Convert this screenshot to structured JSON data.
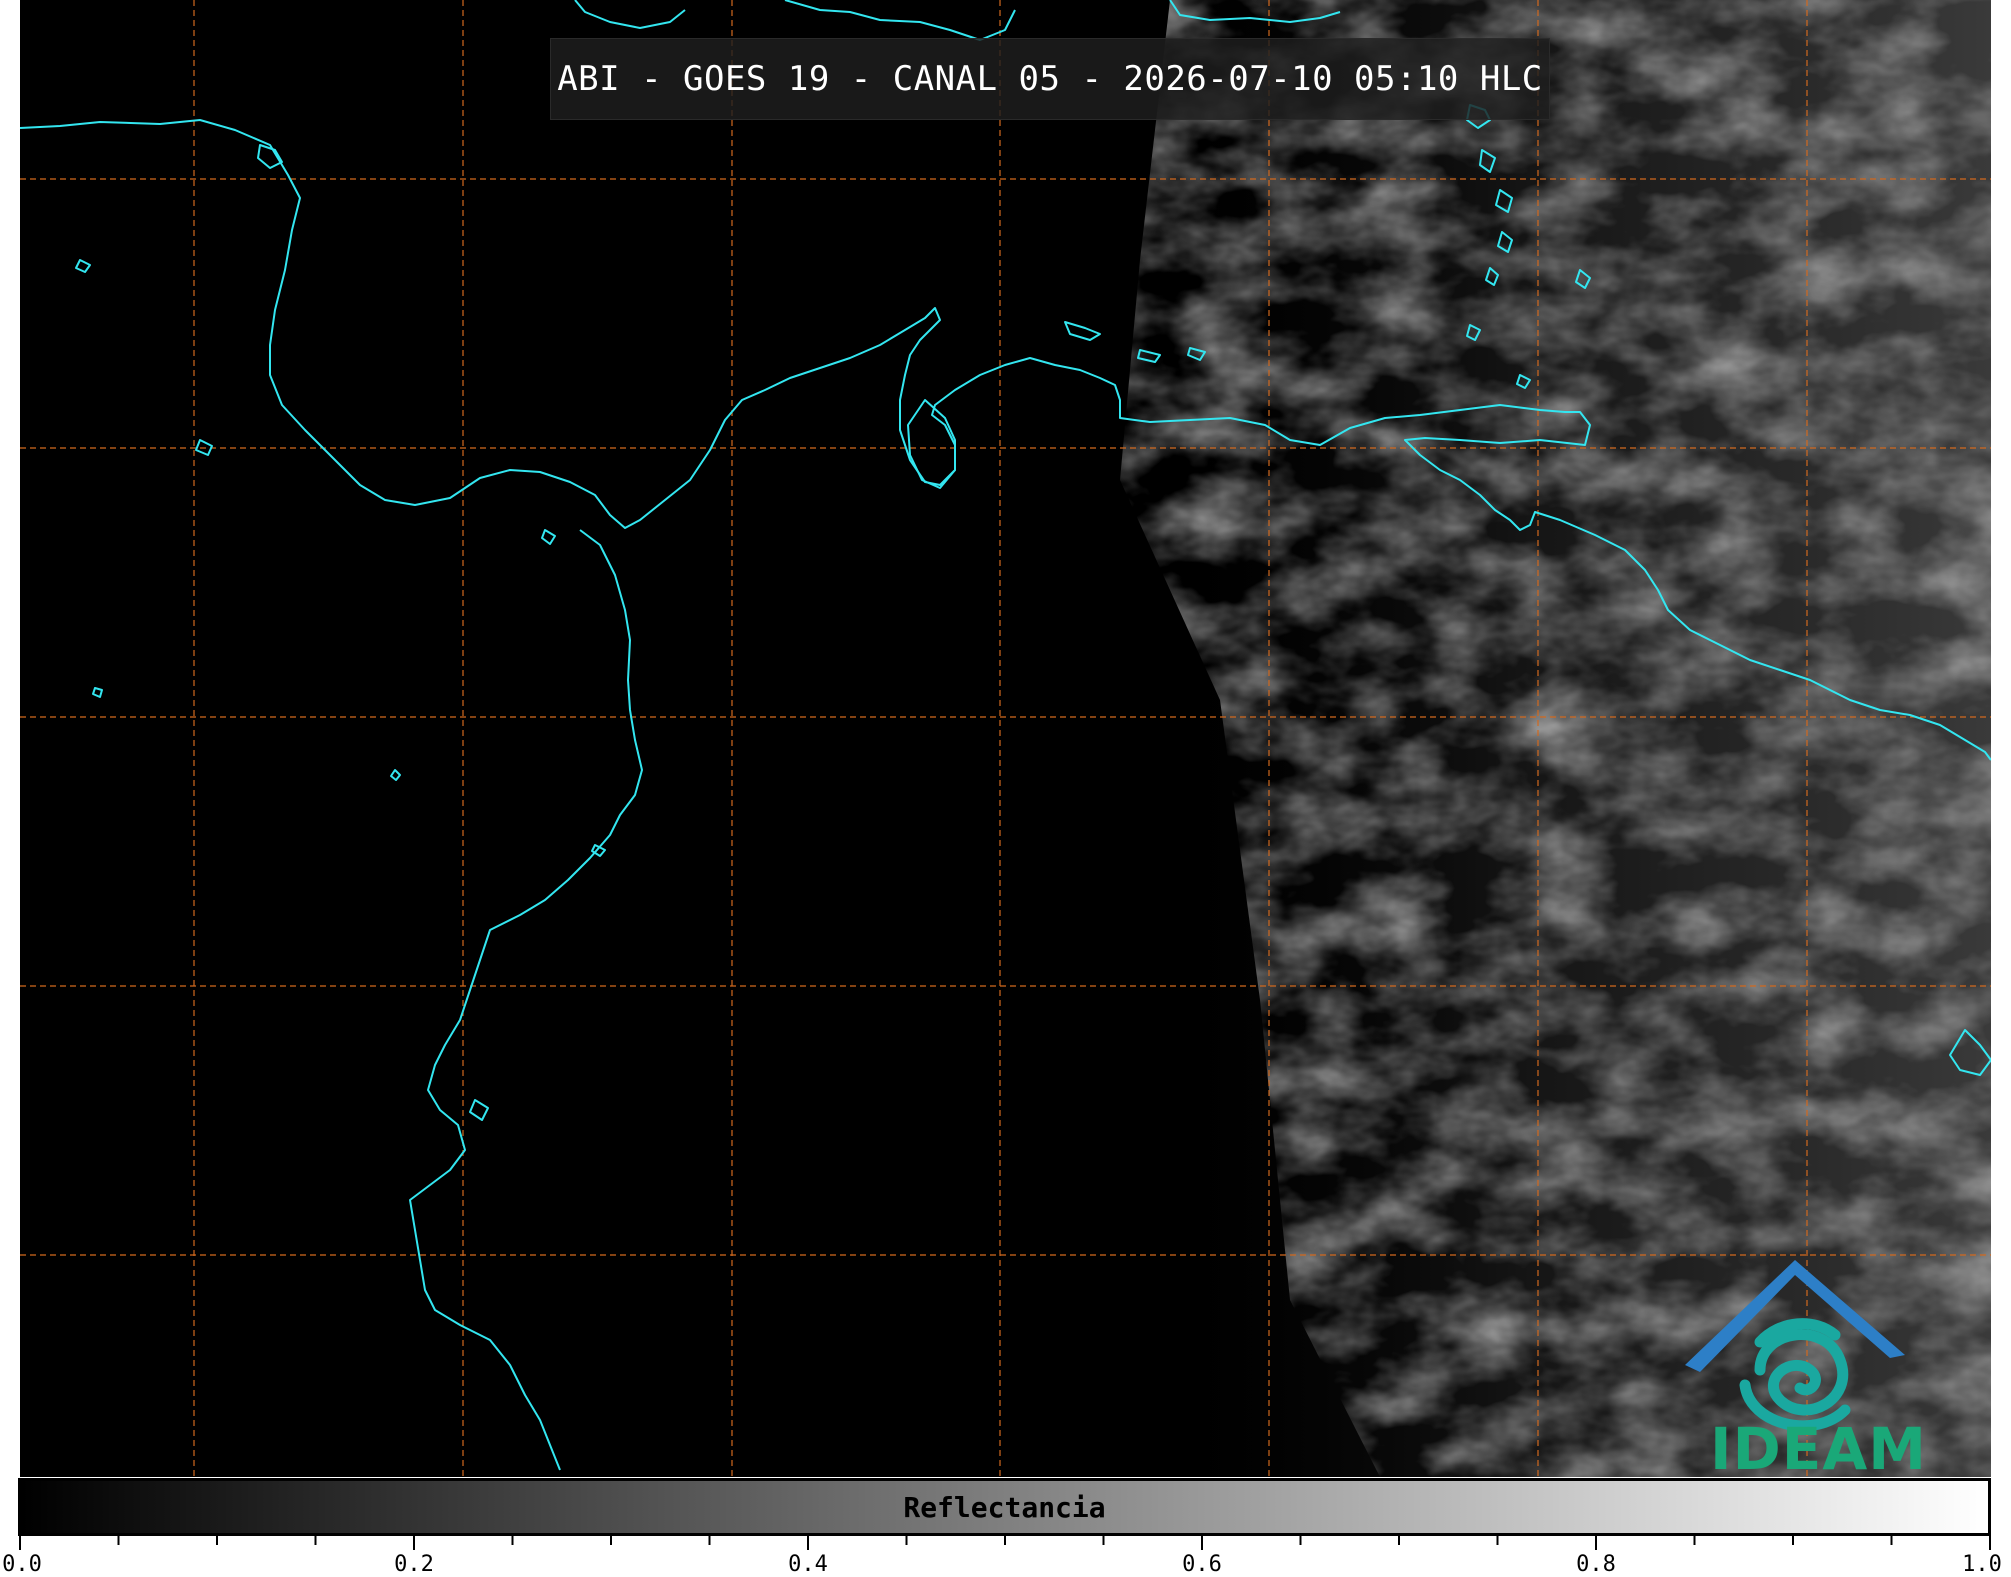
{
  "title": "ABI - GOES 19 - CANAL 05 - 2026-07-10 05:10 HLC",
  "logo": {
    "text": "IDEAM",
    "colors": {
      "roof": "#2d7fc7",
      "swirl": "#1aa8a0",
      "text": "#1aa878"
    }
  },
  "colorbar": {
    "label": "Reflectancia",
    "range": [
      0.0,
      1.0
    ],
    "colormap": "grayscale black-to-white",
    "major_ticks": [
      "0.0",
      "0.2",
      "0.4",
      "0.6",
      "0.8",
      "1.0"
    ],
    "minor_tick_step": 0.05
  },
  "map": {
    "background": "#000000",
    "coastline_color": "#33e6f0",
    "graticule_color": "#d2691e",
    "graticule_style": "dashed",
    "graticule_labels": false,
    "cloud_imagery_side": "right"
  }
}
